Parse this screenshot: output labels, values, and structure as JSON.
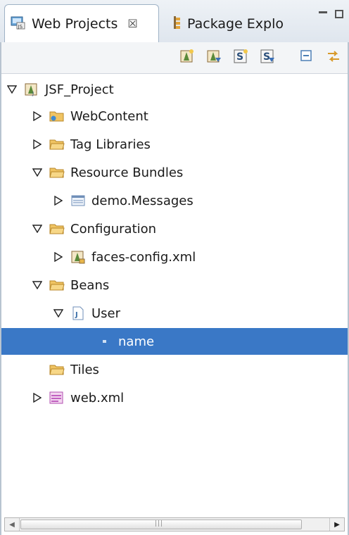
{
  "tabs": {
    "active": {
      "label": "Web Projects",
      "close": "☒"
    },
    "inactive": {
      "label": "Package Explo"
    }
  },
  "tree": {
    "root": "JSF_Project",
    "items": [
      {
        "label": "WebContent"
      },
      {
        "label": "Tag Libraries"
      },
      {
        "label": "Resource Bundles"
      },
      {
        "label": "demo.Messages"
      },
      {
        "label": "Configuration"
      },
      {
        "label": "faces-config.xml"
      },
      {
        "label": "Beans"
      },
      {
        "label": "User"
      },
      {
        "label": "name"
      },
      {
        "label": "Tiles"
      },
      {
        "label": "web.xml"
      }
    ]
  },
  "scrollbar": {
    "grip": "|||"
  },
  "colors": {
    "selection": "#3a78c6",
    "folder": "#e8b64a"
  }
}
